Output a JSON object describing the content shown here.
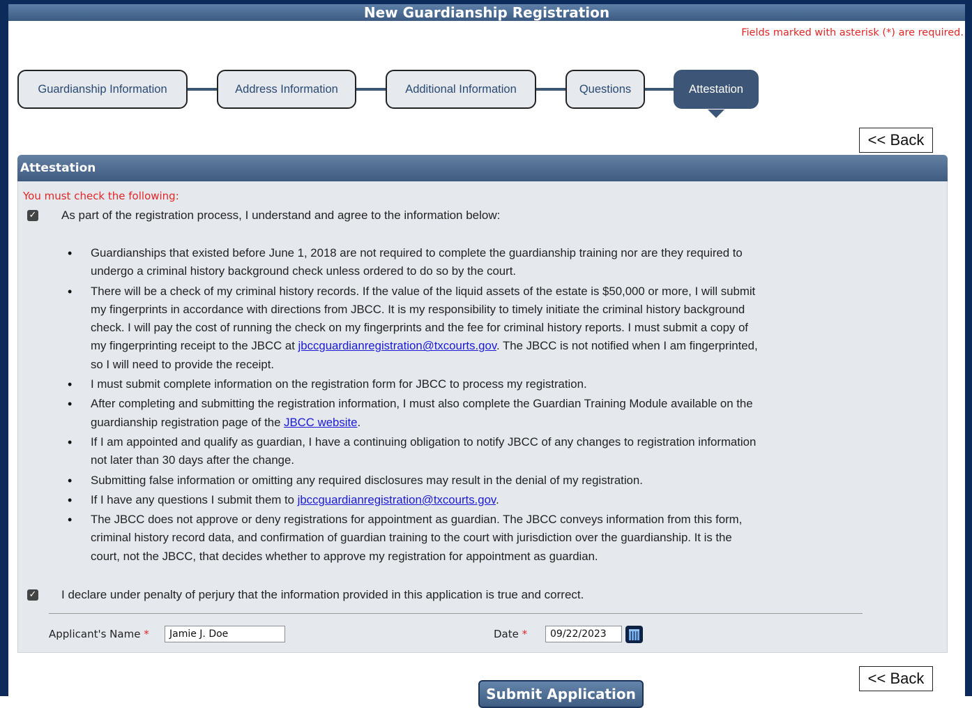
{
  "title": "New Guardianship Registration",
  "required_note": "Fields marked with asterisk (*) are required.",
  "steps": [
    {
      "label": "Guardianship Information"
    },
    {
      "label": "Address Information"
    },
    {
      "label": "Additional Information"
    },
    {
      "label": "Questions"
    },
    {
      "label": "Attestation"
    }
  ],
  "back_label": "<< Back",
  "panel": {
    "title": "Attestation",
    "must_check": "You must check the following:",
    "agree_label": "As part of the registration process, I understand and agree to the information below:",
    "bullets": {
      "b1": "Guardianships that existed before June 1, 2018 are not required to complete the guardianship training nor are they required to undergo a criminal history background check unless ordered to do so by the court.",
      "b2_pre": "There will be a check of my criminal history records. If the value of the liquid assets of the estate is $50,000 or more, I will submit my fingerprints in accordance with directions from JBCC. It is my responsibility to timely initiate the criminal history background check. I will pay the cost of running the check on my fingerprints and the fee for criminal history reports. I must submit a copy of my fingerprinting receipt to the JBCC at ",
      "b2_link": "jbccguardianregistration@txcourts.gov",
      "b2_post": ". The JBCC is not notified when I am fingerprinted, so I will need to provide the receipt.",
      "b3": "I must submit complete information on the registration form for JBCC to process my registration.",
      "b4_pre": "After completing and submitting the registration information, I must also complete the Guardian Training Module available on the guardianship registration page of the ",
      "b4_link": "JBCC website",
      "b4_post": ".",
      "b5": "If I am appointed and qualify as guardian, I have a continuing obligation to notify JBCC of any changes to registration information not later than 30 days after the change.",
      "b6": "Submitting false information or omitting any required disclosures may result in the denial of my registration.",
      "b7_pre": "If I have any questions I submit them to ",
      "b7_link": "jbccguardianregistration@txcourts.gov",
      "b7_post": ".",
      "b8": "The JBCC does not approve or deny registrations for appointment as guardian. The JBCC conveys information from this form, criminal history record data, and confirmation of guardian training to the court with jurisdiction over the guardianship. It is the court, not the JBCC, that decides whether to approve my registration for appointment as guardian."
    },
    "declare_label": "I declare under penalty of perjury that the information provided in this application is true and correct.",
    "applicant_label": "Applicant's Name",
    "applicant_value": "Jamie J. Doe",
    "date_label": "Date",
    "date_value": "09/22/2023",
    "asterisk": "*"
  },
  "submit_label": "Submit Application",
  "colors": {
    "frame": "#0c2a5a",
    "header": "#3f5b80",
    "required": "#e32626",
    "link": "#1a1ad6"
  }
}
